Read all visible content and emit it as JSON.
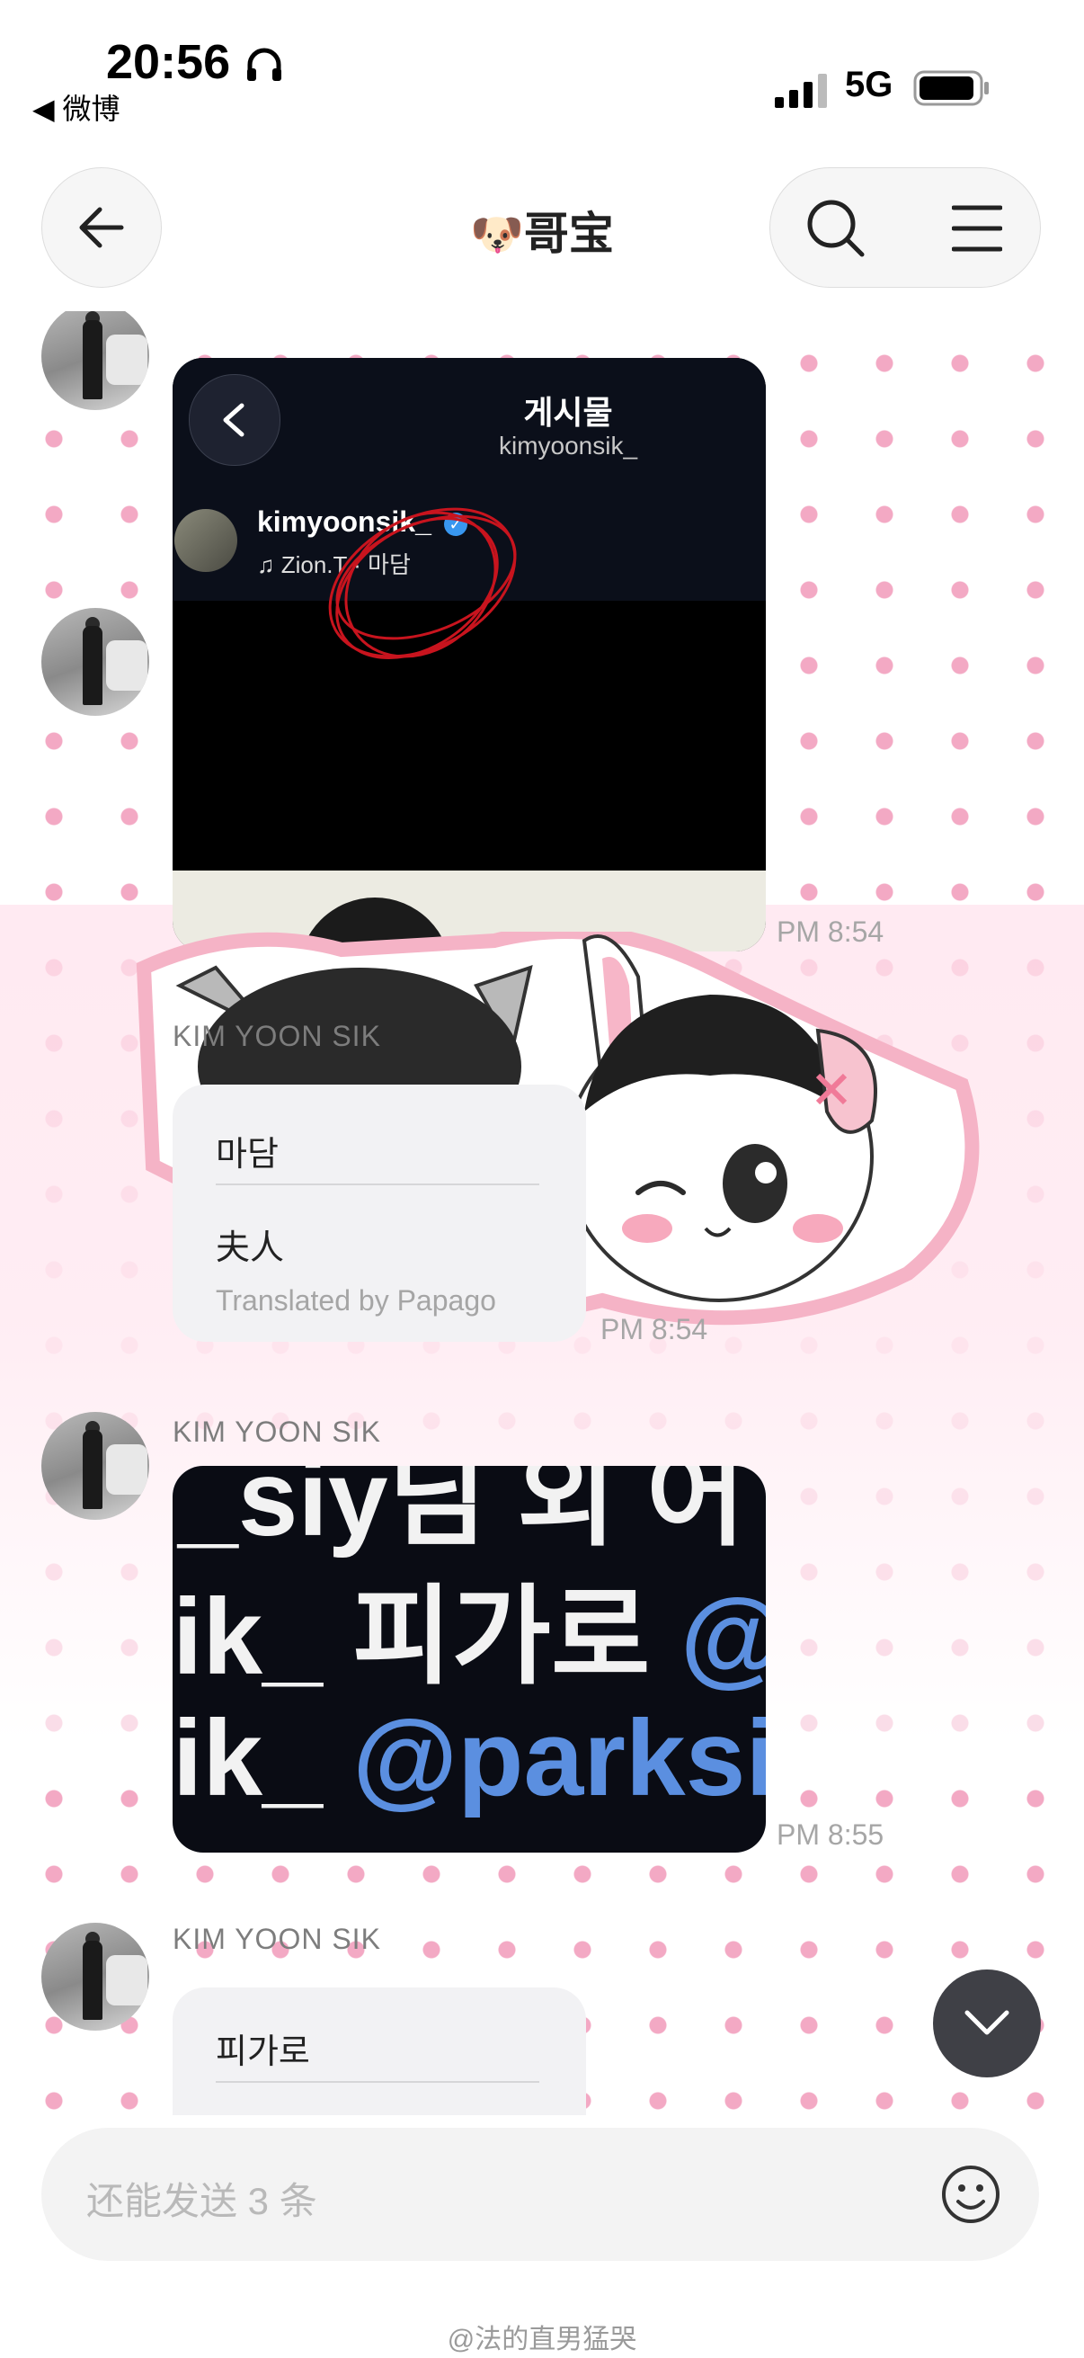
{
  "status_bar": {
    "time": "20:56",
    "back_app": "◀ 微博",
    "network": "5G"
  },
  "header": {
    "title_emoji": "🐶",
    "title": "哥宝"
  },
  "messages": [
    {
      "type": "image",
      "post": {
        "page_title": "게시물",
        "page_subtitle": "kimyoonsik_",
        "username": "kimyoonsik_",
        "music": "♫ Zion.T · 마담"
      },
      "time": "PM 8:54"
    },
    {
      "type": "translated_text",
      "sender": "KIM YOON SIK",
      "original": "마담",
      "translation": "夫人",
      "translated_by": "Translated by Papago",
      "time": "PM 8:54"
    },
    {
      "type": "image",
      "sender": "KIM YOON SIK",
      "image_text": {
        "line1": "_siy님 외 어",
        "line2_a": "ik_ 피가로 ",
        "line2_b": "@",
        "line3_a": "ik_ ",
        "line3_b": "@parksiy"
      },
      "time": "PM 8:55"
    },
    {
      "type": "translated_text",
      "sender": "KIM YOON SIK",
      "original": "피가로"
    }
  ],
  "input": {
    "placeholder": "还能发送 3 条"
  },
  "watermark": "@法的直男猛哭",
  "colors": {
    "dots": "#f3a9c4",
    "bubble": "#f2f2f4",
    "verified": "#3897f0",
    "scribble": "#c8141e"
  },
  "icons": [
    "headphones-icon",
    "signal-icon",
    "battery-icon",
    "back-arrow-icon",
    "search-icon",
    "menu-icon",
    "chevron-down-icon",
    "emoji-icon"
  ]
}
